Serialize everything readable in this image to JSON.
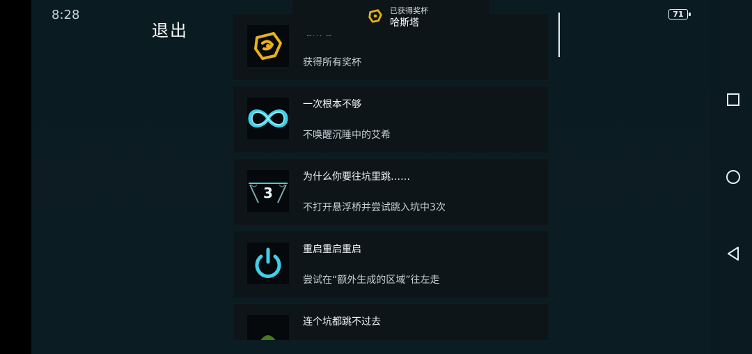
{
  "status_bar": {
    "time": "8:28",
    "battery_level": "71"
  },
  "header": {
    "exit_label": "退出"
  },
  "toast": {
    "label": "已获得奖杯",
    "name": "哈斯塔"
  },
  "achievements": [
    {
      "title": "哈斯塔",
      "desc": "获得所有奖杯",
      "icon": "hastur-emblem-icon"
    },
    {
      "title": "一次根本不够",
      "desc": "不唤醒沉睡中的艾希",
      "icon": "infinity-icon"
    },
    {
      "title": "为什么你要往坑里跳……",
      "desc": "不打开悬浮桥并尝试跳入坑中3次",
      "icon": "bridge-three-icon",
      "badge": "3"
    },
    {
      "title": "重启重启重启",
      "desc": "尝试在“额外生成的区域”往左走",
      "icon": "power-icon"
    },
    {
      "title": "连个坑都跳不过去",
      "desc": "",
      "icon": "green-skull-icon"
    }
  ],
  "nav": {
    "recents": "square-icon",
    "home": "circle-icon",
    "back": "triangle-back-icon"
  },
  "colors": {
    "background": "#0a1a20",
    "card": "#0e1519",
    "accent_cyan": "#3fd0e8",
    "gold": "#e8b21a"
  }
}
